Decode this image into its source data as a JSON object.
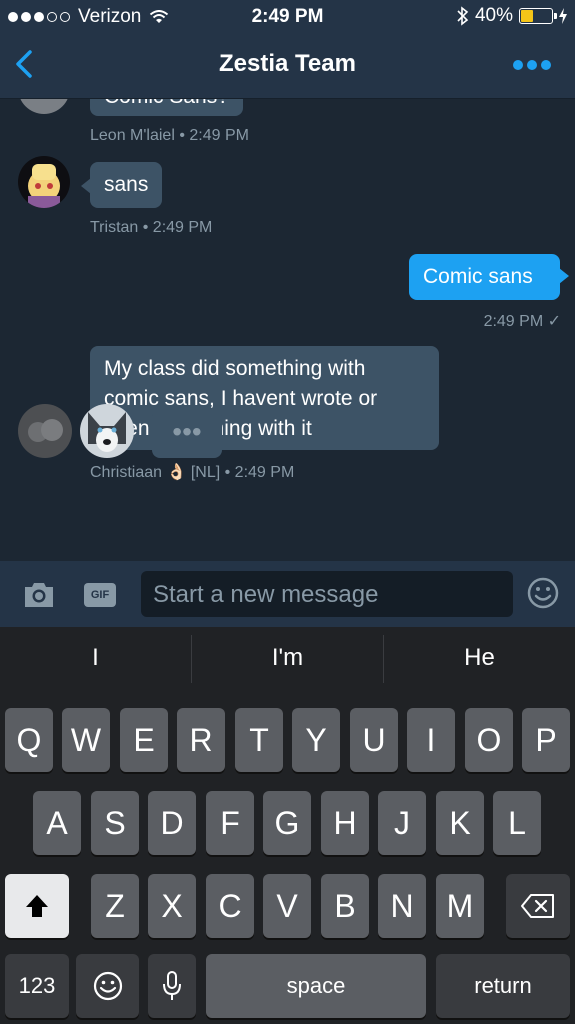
{
  "status": {
    "carrier": "Verizon",
    "time": "2:49 PM",
    "battery": "40%"
  },
  "header": {
    "title": "Zestia Team"
  },
  "messages": {
    "partial_text": "Comic Sans?",
    "m1_meta": "Leon M'laiel • 2:49 PM",
    "m2_text": "sans",
    "m2_meta": "Tristan • 2:49 PM",
    "m3_text": "Comic sans",
    "m3_meta": "2:49 PM ✓",
    "m4_line1": "My class did something with",
    "m4_line2": "comic sans, I havent wrote or",
    "m4_line3": "seen something with it",
    "m4_meta": "Christiaan 👌🏻 [NL] • 2:49 PM"
  },
  "composer": {
    "placeholder": "Start a new message",
    "gif_label": "GIF"
  },
  "keyboard": {
    "suggestions": [
      "I",
      "I'm",
      "He"
    ],
    "row1": [
      "Q",
      "W",
      "E",
      "R",
      "T",
      "Y",
      "U",
      "I",
      "O",
      "P"
    ],
    "row2": [
      "A",
      "S",
      "D",
      "F",
      "G",
      "H",
      "J",
      "K",
      "L"
    ],
    "row3": [
      "Z",
      "X",
      "C",
      "V",
      "B",
      "N",
      "M"
    ],
    "numbers_label": "123",
    "space_label": "space",
    "return_label": "return"
  }
}
